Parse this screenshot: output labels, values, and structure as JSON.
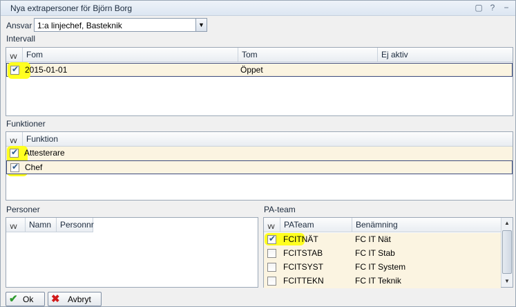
{
  "window": {
    "title": "Nya extrapersoner för Björn Borg",
    "icons": [
      "pin-icon",
      "help-icon",
      "close-icon"
    ]
  },
  "ansvar": {
    "label": "Ansvar",
    "value": "1:a linjechef, Basteknik"
  },
  "intervall": {
    "label": "Intervall",
    "columns": [
      "Fom",
      "Tom",
      "Ej aktiv"
    ],
    "rows": [
      {
        "checked": true,
        "fom": "2015-01-01",
        "tom": "Öppet",
        "ej_aktiv": ""
      }
    ]
  },
  "funktioner": {
    "label": "Funktioner",
    "columns": [
      "Funktion"
    ],
    "rows": [
      {
        "checked": true,
        "funktion": "Attesterare"
      },
      {
        "checked": true,
        "funktion": "Chef"
      }
    ]
  },
  "personer": {
    "label": "Personer",
    "columns": [
      "Namn",
      "Personnr"
    ]
  },
  "pateam": {
    "label": "PA-team",
    "columns": [
      "PATeam",
      "Benämning"
    ],
    "rows": [
      {
        "checked": true,
        "team": "FCITNÄT",
        "benamning": "FC IT Nät"
      },
      {
        "checked": false,
        "team": "FCITSTAB",
        "benamning": "FC IT Stab"
      },
      {
        "checked": false,
        "team": "FCITSYST",
        "benamning": "FC IT System"
      },
      {
        "checked": false,
        "team": "FCITTEKN",
        "benamning": "FC IT Teknik"
      }
    ]
  },
  "buttons": {
    "ok": "Ok",
    "avbryt": "Avbryt"
  },
  "colors": {
    "highlight": "#ffff20",
    "row_bg": "#fbf4e1",
    "selected_border": "#3c4a7c",
    "cancel_icon": "#d11a1a",
    "ok_icon": "#2f9a2f"
  }
}
